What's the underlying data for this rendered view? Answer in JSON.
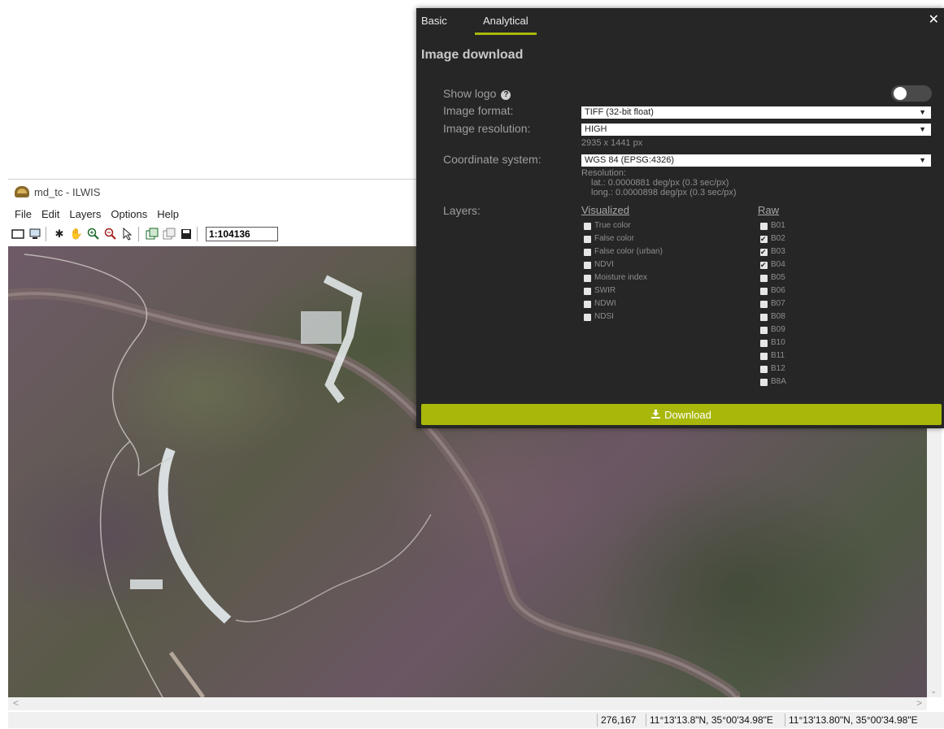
{
  "ilwis": {
    "title": "md_tc - ILWIS",
    "menu": [
      "File",
      "Edit",
      "Layers",
      "Options",
      "Help"
    ],
    "scale": "1:104136",
    "status": {
      "pixel": "276,167",
      "coord1": "11°13'13.8\"N, 35°00'34.98\"E",
      "coord2": "11°13'13.80\"N, 35°00'34.98\"E"
    }
  },
  "dialog": {
    "tabs": [
      "Basic",
      "Analytical"
    ],
    "active_tab": "Analytical",
    "close": "✕",
    "title": "Image download",
    "show_logo_label": "Show logo",
    "image_format_label": "Image format:",
    "image_format_value": "TIFF (32-bit float)",
    "image_resolution_label": "Image resolution:",
    "image_resolution_value": "HIGH",
    "image_size": "2935 x 1441 px",
    "coordinate_system_label": "Coordinate system:",
    "coordinate_system_value": "WGS 84 (EPSG:4326)",
    "resolution_heading": "Resolution:",
    "resolution_lat": "lat.: 0.0000881 deg/px (0.3 sec/px)",
    "resolution_long": "long.: 0.0000898 deg/px (0.3 sec/px)",
    "layers_label": "Layers:",
    "visualized_heading": "Visualized",
    "raw_heading": "Raw",
    "visualized": [
      {
        "label": "True color",
        "checked": false
      },
      {
        "label": "False color",
        "checked": false
      },
      {
        "label": "False color (urban)",
        "checked": false
      },
      {
        "label": "NDVI",
        "checked": false
      },
      {
        "label": "Moisture index",
        "checked": false
      },
      {
        "label": "SWIR",
        "checked": false
      },
      {
        "label": "NDWI",
        "checked": false
      },
      {
        "label": "NDSI",
        "checked": false
      }
    ],
    "raw": [
      {
        "label": "B01",
        "checked": false
      },
      {
        "label": "B02",
        "checked": true
      },
      {
        "label": "B03",
        "checked": true
      },
      {
        "label": "B04",
        "checked": true
      },
      {
        "label": "B05",
        "checked": false
      },
      {
        "label": "B06",
        "checked": false
      },
      {
        "label": "B07",
        "checked": false
      },
      {
        "label": "B08",
        "checked": false
      },
      {
        "label": "B09",
        "checked": false
      },
      {
        "label": "B10",
        "checked": false
      },
      {
        "label": "B11",
        "checked": false
      },
      {
        "label": "B12",
        "checked": false
      },
      {
        "label": "B8A",
        "checked": false
      }
    ],
    "download_label": "Download",
    "accent_color": "#a9b70b"
  }
}
